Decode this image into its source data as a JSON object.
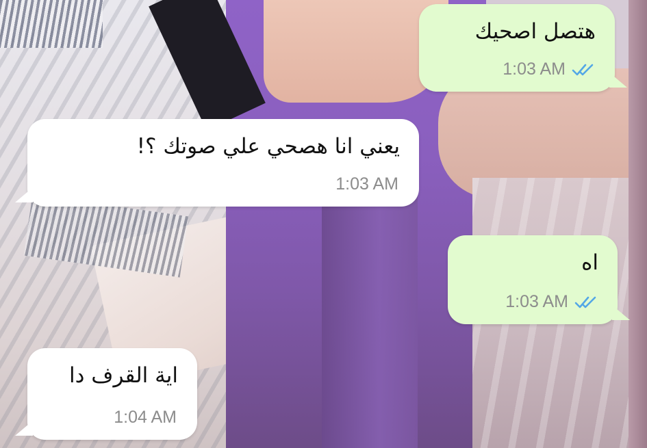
{
  "chat": {
    "messages": [
      {
        "direction": "outgoing",
        "text": "هتصل اصحيك",
        "time": "1:03 AM",
        "status": "read",
        "status_icon": "double-check-icon"
      },
      {
        "direction": "incoming",
        "text": "يعني انا هصحي علي صوتك ؟!",
        "time": "1:03 AM"
      },
      {
        "direction": "outgoing",
        "text": "اه",
        "time": "1:03 AM",
        "status": "read",
        "status_icon": "double-check-icon"
      },
      {
        "direction": "incoming",
        "text": "اية القرف دا",
        "time": "1:04 AM"
      }
    ]
  },
  "colors": {
    "outgoing_bubble": "#e2fbcf",
    "incoming_bubble": "#ffffff",
    "read_ticks": "#53a7e6",
    "timestamp": "#8c8c8c"
  }
}
